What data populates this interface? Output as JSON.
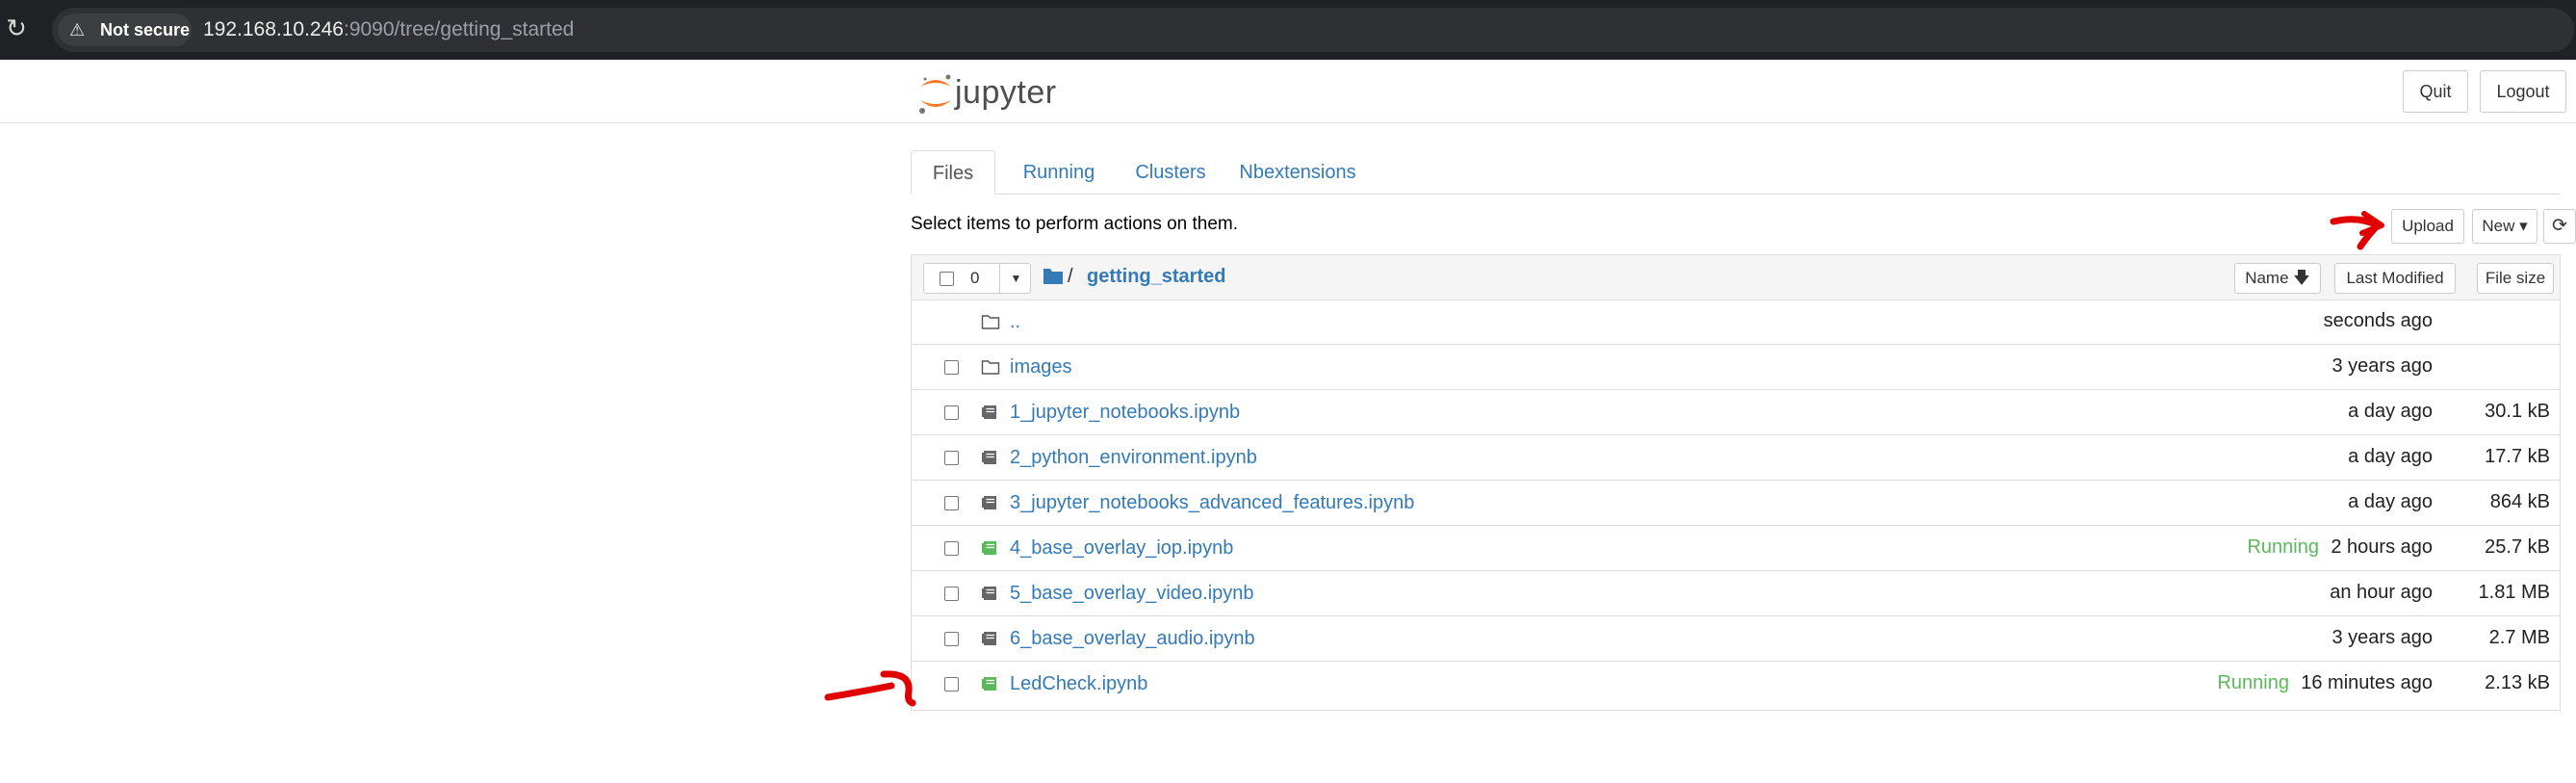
{
  "browser": {
    "security_label": "Not secure",
    "url_host": "192.168.10.246",
    "url_path": ":9090/tree/getting_started"
  },
  "header": {
    "logo_text": "jupyter",
    "quit_label": "Quit",
    "logout_label": "Logout"
  },
  "tabs": [
    {
      "label": "Files",
      "active": true
    },
    {
      "label": "Running",
      "active": false
    },
    {
      "label": "Clusters",
      "active": false
    },
    {
      "label": "Nbextensions",
      "active": false
    }
  ],
  "toolbar": {
    "select_message": "Select items to perform actions on them.",
    "upload_label": "Upload",
    "new_label": "New"
  },
  "list_header": {
    "selected_count": "0",
    "breadcrumb_separator": "/",
    "current_dir": "getting_started",
    "sort_name": "Name",
    "sort_modified": "Last Modified",
    "sort_size": "File size"
  },
  "files": [
    {
      "name": "..",
      "type": "parent",
      "status": "",
      "modified": "seconds ago",
      "size": ""
    },
    {
      "name": "images",
      "type": "folder",
      "status": "",
      "modified": "3 years ago",
      "size": ""
    },
    {
      "name": "1_jupyter_notebooks.ipynb",
      "type": "notebook",
      "status": "",
      "modified": "a day ago",
      "size": "30.1 kB"
    },
    {
      "name": "2_python_environment.ipynb",
      "type": "notebook",
      "status": "",
      "modified": "a day ago",
      "size": "17.7 kB"
    },
    {
      "name": "3_jupyter_notebooks_advanced_features.ipynb",
      "type": "notebook",
      "status": "",
      "modified": "a day ago",
      "size": "864 kB"
    },
    {
      "name": "4_base_overlay_iop.ipynb",
      "type": "notebook-running",
      "status": "Running",
      "modified": "2 hours ago",
      "size": "25.7 kB"
    },
    {
      "name": "5_base_overlay_video.ipynb",
      "type": "notebook",
      "status": "",
      "modified": "an hour ago",
      "size": "1.81 MB"
    },
    {
      "name": "6_base_overlay_audio.ipynb",
      "type": "notebook",
      "status": "",
      "modified": "3 years ago",
      "size": "2.7 MB"
    },
    {
      "name": "LedCheck.ipynb",
      "type": "notebook-running",
      "status": "Running",
      "modified": "16 minutes ago",
      "size": "2.13 kB"
    }
  ],
  "colors": {
    "link": "#337ab7",
    "running": "#5cb85c",
    "annotation": "#e00000",
    "jupyter_orange": "#f37726"
  },
  "icons": {
    "reload": "reload-icon",
    "warning": "warning-icon",
    "folder": "folder-icon",
    "notebook": "notebook-icon",
    "sort_down": "arrow-down-icon",
    "caret": "caret-down-icon",
    "refresh": "refresh-icon"
  }
}
